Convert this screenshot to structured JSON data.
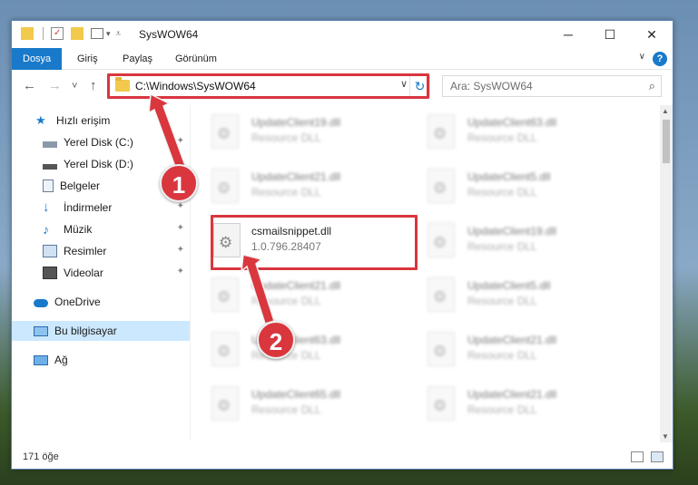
{
  "window": {
    "title": "SysWOW64",
    "minimize_glyph": "─",
    "maximize_glyph": "☐",
    "close_glyph": "✕"
  },
  "ribbon": {
    "tabs": [
      "Dosya",
      "Giriş",
      "Paylaş",
      "Görünüm"
    ],
    "active_tab": "Dosya",
    "help_glyph": "?",
    "expand_glyph": "∨"
  },
  "nav": {
    "back_glyph": "←",
    "forward_glyph": "→",
    "recent_glyph": "˅",
    "up_glyph": "↑",
    "address": "C:\\Windows\\SysWOW64",
    "dropdown_glyph": "∨",
    "refresh_glyph": "↻",
    "search_placeholder": "Ara: SysWOW64",
    "search_glyph": "⌕"
  },
  "sidebar": {
    "quick_access": "Hızlı erişim",
    "items": [
      {
        "label": "Yerel Disk (C:)",
        "icon": "drive-icon",
        "pinned": true
      },
      {
        "label": "Yerel Disk (D:)",
        "icon": "drive-icon",
        "pinned": true
      },
      {
        "label": "Belgeler",
        "icon": "documents-icon",
        "pinned": true
      },
      {
        "label": "İndirmeler",
        "icon": "downloads-icon",
        "pinned": true
      },
      {
        "label": "Müzik",
        "icon": "music-icon",
        "pinned": true
      },
      {
        "label": "Resimler",
        "icon": "pictures-icon",
        "pinned": true
      },
      {
        "label": "Videolar",
        "icon": "videos-icon",
        "pinned": true
      }
    ],
    "onedrive": "OneDrive",
    "this_pc": "Bu bilgisayar",
    "network": "Ağ",
    "pin_glyph": "✦"
  },
  "files": {
    "left_column": [
      {
        "name": "UpdateClient19.dll",
        "desc": "Resource DLL"
      },
      {
        "name": "UpdateClient21.dll",
        "desc": "Resource DLL"
      },
      {
        "name": "csmailsnippet.dll",
        "desc": "1.0.796.28407"
      },
      {
        "name": "UpdateClient21.dll",
        "desc": "Resource DLL"
      },
      {
        "name": "UpdateClient63.dll",
        "desc": "Resource DLL"
      },
      {
        "name": "UpdateClient65.dll",
        "desc": "Resource DLL"
      }
    ],
    "right_column": [
      {
        "name": "UpdateClient63.dll",
        "desc": "Resource DLL"
      },
      {
        "name": "UpdateClient5.dll",
        "desc": "Resource DLL"
      },
      {
        "name": "UpdateClient19.dll",
        "desc": "Resource DLL"
      },
      {
        "name": "UpdateClient5.dll",
        "desc": "Resource DLL"
      },
      {
        "name": "UpdateClient21.dll",
        "desc": "Resource DLL"
      },
      {
        "name": "UpdateClient21.dll",
        "desc": "Resource DLL"
      }
    ]
  },
  "status": {
    "item_count": "171 öğe"
  },
  "annotations": {
    "step1": "1",
    "step2": "2",
    "color": "#d9363e"
  },
  "colors": {
    "accent": "#1979ca",
    "selection": "#cce8ff"
  }
}
